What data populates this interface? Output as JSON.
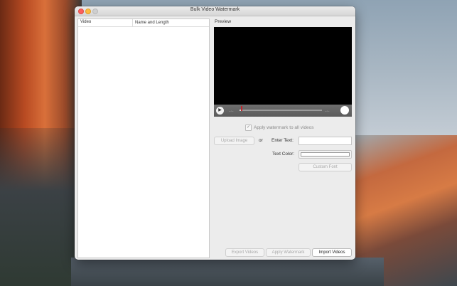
{
  "window": {
    "title": "Bulk Video Watermark"
  },
  "table": {
    "columns": [
      "Video",
      "Name and Length"
    ]
  },
  "preview": {
    "label": "Preview",
    "time_elapsed": "--:--",
    "time_remaining": "--:--",
    "progress": 0.03
  },
  "options": {
    "apply_all_label": "Apply watermark to all videos",
    "apply_all_checked": true,
    "upload_image_label": "Upload Image",
    "or_label": "or",
    "enter_text_label": "Enter Text:",
    "enter_text_value": "",
    "text_color_label": "Text Color:",
    "text_color_value": "#ffffff",
    "custom_font_label": "Custom Font"
  },
  "actions": {
    "export_label": "Export Videos",
    "apply_label": "Apply Watermark",
    "import_label": "Import Videos"
  },
  "colors": {
    "close": "#fc605c",
    "minimize": "#fdbc40",
    "playhead": "#c1272d"
  },
  "icons": [
    "close-icon",
    "minimize-icon",
    "zoom-icon",
    "play-icon",
    "volume-icon",
    "checkmark-icon"
  ]
}
